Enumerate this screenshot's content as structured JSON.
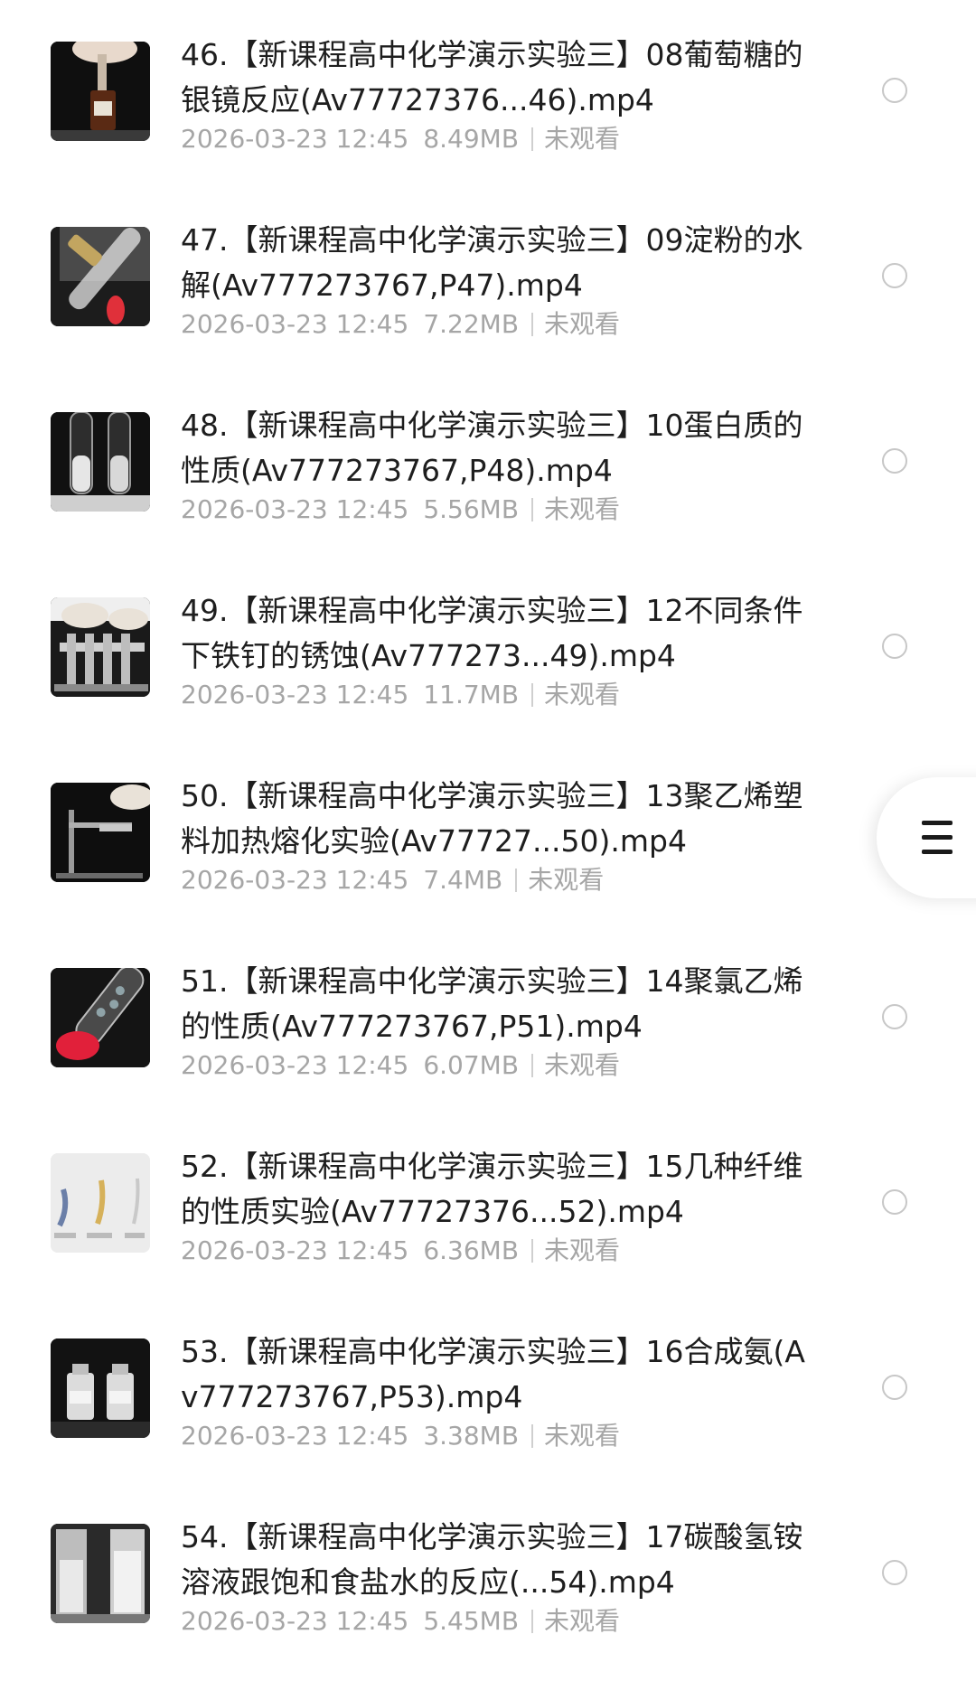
{
  "files": [
    {
      "title": "46.【新课程高中化学演示实验三】08葡萄糖的银镜反应(Av77727376...46).mp4",
      "date": "2026-03-23 12:45",
      "size": "8.49MB",
      "status": "未观看",
      "thumbnail_icon": "dropper-bottle-thumbnail"
    },
    {
      "title": "47.【新课程高中化学演示实验三】09淀粉的水解(Av777273767,P47).mp4",
      "date": "2026-03-23 12:45",
      "size": "7.22MB",
      "status": "未观看",
      "thumbnail_icon": "test-tube-flame-thumbnail"
    },
    {
      "title": "48.【新课程高中化学演示实验三】10蛋白质的性质(Av777273767,P48).mp4",
      "date": "2026-03-23 12:45",
      "size": "5.56MB",
      "status": "未观看",
      "thumbnail_icon": "two-test-tubes-thumbnail"
    },
    {
      "title": "49.【新课程高中化学演示实验三】12不同条件下铁钉的锈蚀(Av777273...49).mp4",
      "date": "2026-03-23 12:45",
      "size": "11.7MB",
      "status": "未观看",
      "thumbnail_icon": "tube-rack-thumbnail"
    },
    {
      "title": "50.【新课程高中化学演示实验三】13聚乙烯塑料加热熔化实验(Av77727...50).mp4",
      "date": "2026-03-23 12:45",
      "size": "7.4MB",
      "status": "未观看",
      "thumbnail_icon": "clamp-heating-thumbnail"
    },
    {
      "title": "51.【新课程高中化学演示实验三】14聚氯乙烯的性质(Av777273767,P51).mp4",
      "date": "2026-03-23 12:45",
      "size": "6.07MB",
      "status": "未观看",
      "thumbnail_icon": "tube-red-flame-thumbnail"
    },
    {
      "title": "52.【新课程高中化学演示实验三】15几种纤维的性质实验(Av77727376...52).mp4",
      "date": "2026-03-23 12:45",
      "size": "6.36MB",
      "status": "未观看",
      "thumbnail_icon": "fibers-thumbnail"
    },
    {
      "title": "53.【新课程高中化学演示实验三】16合成氨(Av777273767,P53).mp4",
      "date": "2026-03-23 12:45",
      "size": "3.38MB",
      "status": "未观看",
      "thumbnail_icon": "reagent-bottles-thumbnail"
    },
    {
      "title": "54.【新课程高中化学演示实验三】17碳酸氢铵溶液跟饱和食盐水的反应(...54).mp4",
      "date": "2026-03-23 12:45",
      "size": "5.45MB",
      "status": "未观看",
      "thumbnail_icon": "beakers-thumbnail"
    }
  ],
  "floating_menu": {
    "icon": "menu-icon"
  }
}
